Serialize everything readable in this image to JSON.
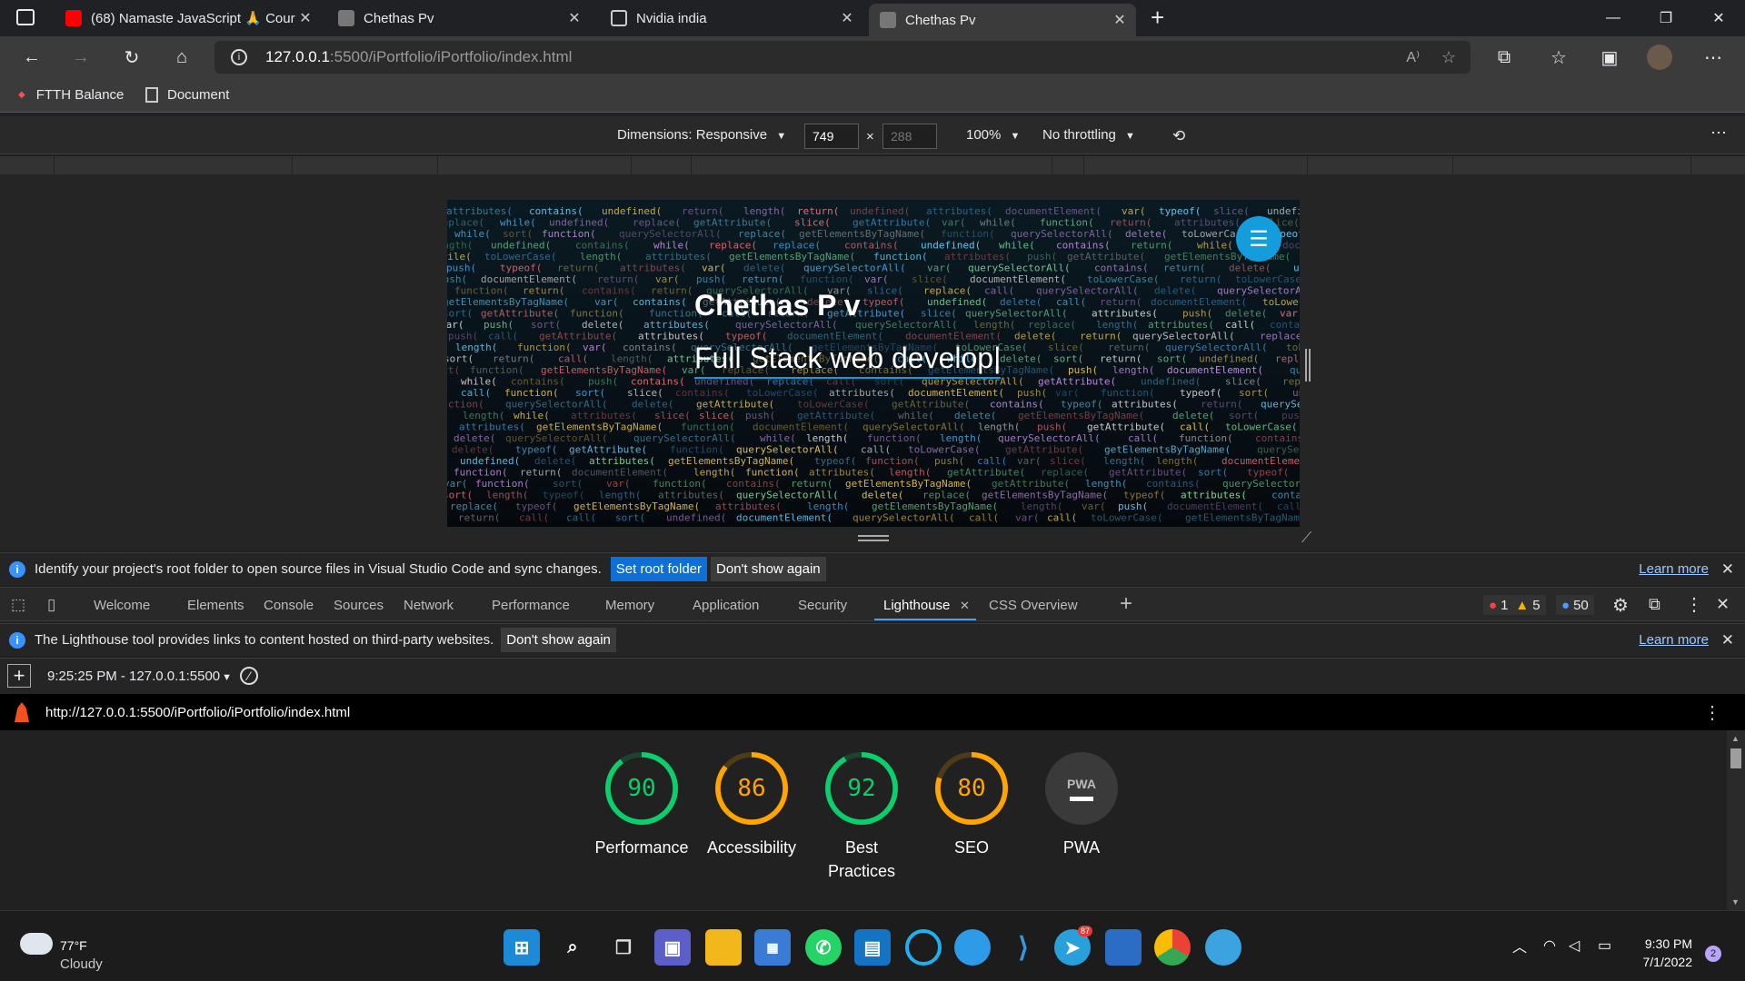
{
  "tabs": [
    {
      "title": "(68) Namaste JavaScript 🙏 Cour",
      "icon": "youtube-icon",
      "color": "#ff0000"
    },
    {
      "title": "Chethas Pv",
      "icon": "site-thumb-icon",
      "color": "#888888"
    },
    {
      "title": "Nvidia india",
      "icon": "document-icon",
      "color": "#cccccc"
    },
    {
      "title": "Chethas Pv",
      "icon": "site-thumb-icon",
      "color": "#888888"
    }
  ],
  "address": {
    "host": "127.0.0.1",
    "path": ":5500/iPortfolio/iPortfolio/index.html"
  },
  "bookmarks": [
    "FTTH Balance",
    "Document"
  ],
  "device_bar": {
    "dimensions": "Dimensions: Responsive",
    "width": "749",
    "height": "288",
    "zoom": "100%",
    "throttle": "No throttling"
  },
  "site": {
    "name": "Chethas P v",
    "role": "Full Stack web develop|"
  },
  "infobar1": {
    "text": "Identify your project's root folder to open source files in Visual Studio Code and sync changes.",
    "set_root": "Set root folder",
    "dont_show": "Don't show again",
    "learn": "Learn more"
  },
  "devtools_tabs": [
    "Welcome",
    "Elements",
    "Console",
    "Sources",
    "Network",
    "Performance",
    "Memory",
    "Application",
    "Security",
    "Lighthouse",
    "CSS Overview"
  ],
  "counts": {
    "errors": "1",
    "warnings": "5",
    "issues": "50"
  },
  "infobar2": {
    "text": "The Lighthouse tool provides links to content hosted on third-party websites.",
    "dont_show": "Don't show again",
    "learn": "Learn more"
  },
  "lighthouse": {
    "run": "9:25:25 PM - 127.0.0.1:5500",
    "url": "http://127.0.0.1:5500/iPortfolio/iPortfolio/index.html",
    "scores": [
      {
        "label": "Performance",
        "value": "90",
        "pct": 90,
        "color": "#0cce6b"
      },
      {
        "label": "Accessibility",
        "value": "86",
        "pct": 86,
        "color": "#ffa400"
      },
      {
        "label": "Best Practices",
        "value": "92",
        "pct": 92,
        "color": "#0cce6b"
      },
      {
        "label": "SEO",
        "value": "80",
        "pct": 80,
        "color": "#ffa400"
      },
      {
        "label": "PWA",
        "value": "PWA",
        "pct": 0,
        "color": "#9e9e9e"
      }
    ]
  },
  "weather": {
    "temp": "77°F",
    "desc": "Cloudy"
  },
  "clock": {
    "time": "9:30 PM",
    "date": "7/1/2022"
  },
  "notifications": "2",
  "telegram_badge": "87"
}
